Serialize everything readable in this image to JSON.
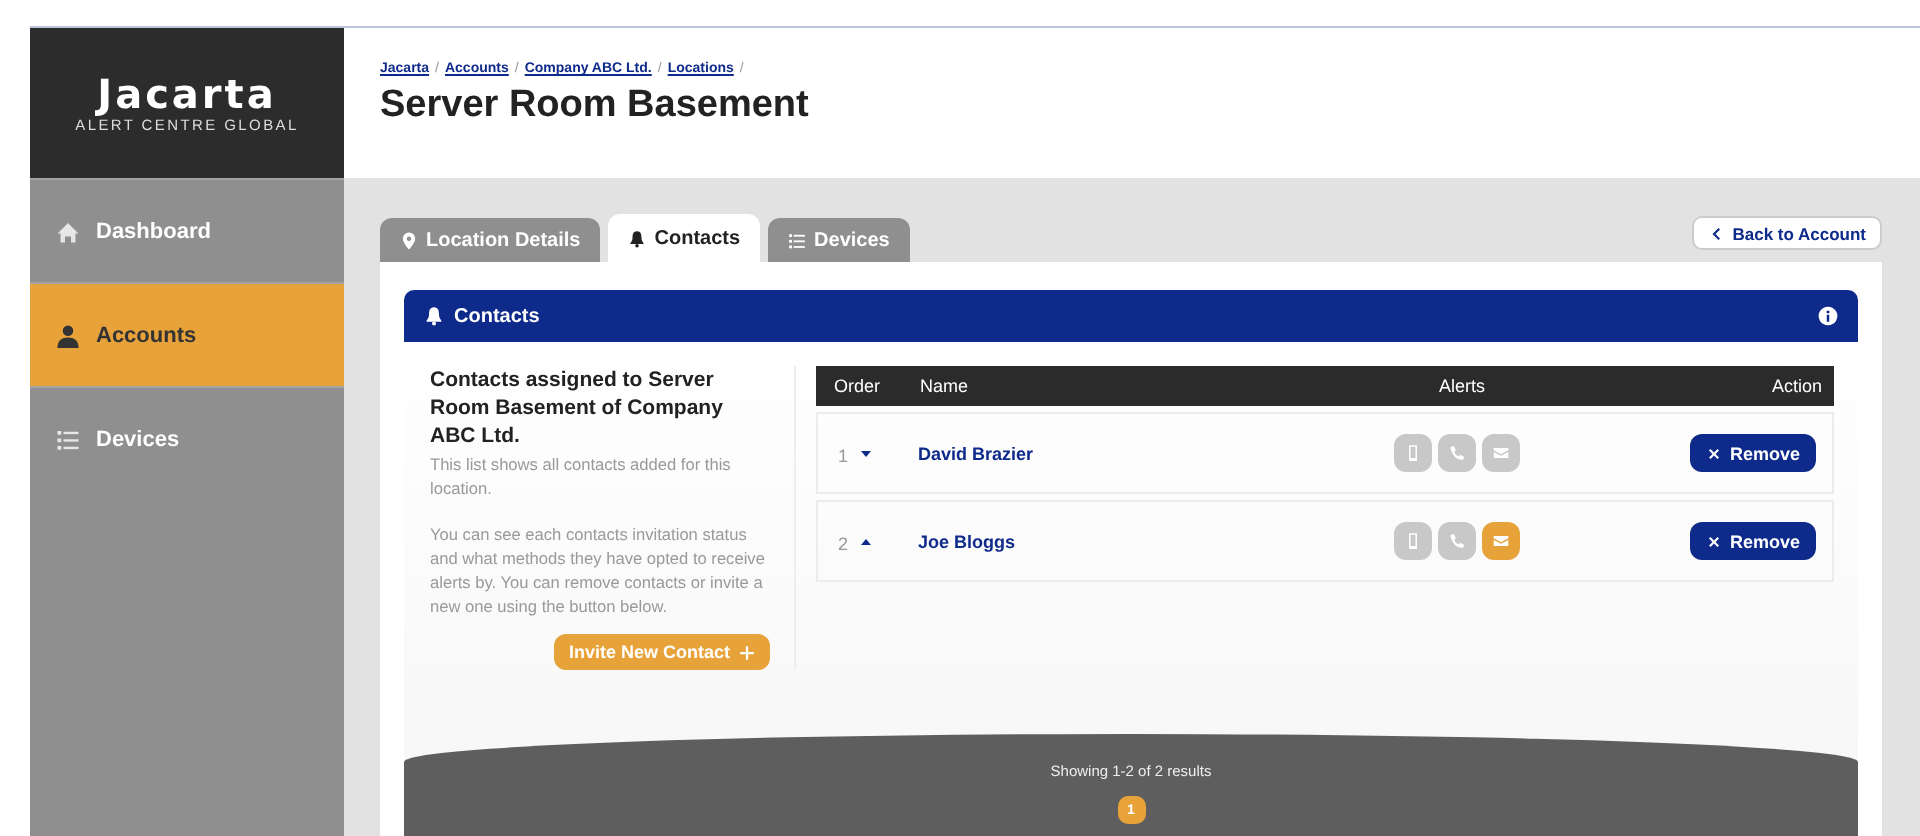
{
  "brand": {
    "name": "Jacarta",
    "tagline": "ALERT CENTRE GLOBAL"
  },
  "sidebar": {
    "items": [
      {
        "label": "Dashboard",
        "selected": false
      },
      {
        "label": "Accounts",
        "selected": true
      },
      {
        "label": "Devices",
        "selected": false
      }
    ]
  },
  "breadcrumb": {
    "items": [
      "Jacarta",
      "Accounts",
      "Company ABC Ltd.",
      "Locations"
    ],
    "separator": "/"
  },
  "title": "Server Room Basement",
  "tabs": [
    {
      "label": "Location Details",
      "selected": false
    },
    {
      "label": "Contacts",
      "selected": true
    },
    {
      "label": "Devices",
      "selected": false
    }
  ],
  "back_button": "Back to Account",
  "panel": {
    "title": "Contacts",
    "intro_heading": "Contacts assigned to Server Room Basement of Company ABC Ltd.",
    "intro_paragraphs": [
      "This list shows all contacts added for this location.",
      "You can see each contacts invitation status and what methods they have opted to receive alerts by. You can remove contacts or invite a new one using the button below."
    ],
    "invite_button": "Invite New Contact"
  },
  "table": {
    "columns": [
      "Order",
      "Name",
      "Alerts",
      "Action"
    ],
    "rows": [
      {
        "order": "1",
        "kind": "down",
        "name": "David Brazier",
        "alerts": [
          {
            "kind": "mobile",
            "on": false
          },
          {
            "kind": "phone",
            "on": false
          },
          {
            "kind": "email",
            "on": false
          }
        ],
        "action": "Remove"
      },
      {
        "order": "2",
        "kind": "up",
        "name": "Joe Bloggs",
        "alerts": [
          {
            "kind": "mobile",
            "on": false
          },
          {
            "kind": "phone",
            "on": false
          },
          {
            "kind": "email",
            "on": true
          }
        ],
        "action": "Remove"
      }
    ]
  },
  "pagination": {
    "summary": "Showing 1-2 of 2 results",
    "pages": [
      {
        "label": "1",
        "selected": true
      }
    ]
  }
}
